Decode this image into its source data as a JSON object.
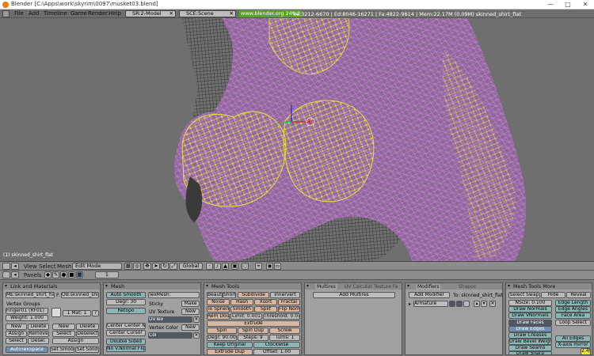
{
  "window": {
    "title": "Blender [C:\\Apps\\work\\skyrim\\0097\\musket03.blend]",
    "min": "—",
    "max": "□",
    "close": "✕"
  },
  "menu": {
    "items": [
      "File",
      "Add",
      "Timeline",
      "Game",
      "Render",
      "Help"
    ],
    "screen": "SR:2-Model",
    "scene": "SCE:Scene",
    "url": "www.blender.org 249.2",
    "stats": "Ve:3212-6670 | Ed:8046-16271 | Fa:4822-9614 | Mem:22.17M (0.09M) skinned_shirt_flat"
  },
  "viewport": {
    "object_label": "(1) skinned_shirt_flat"
  },
  "header3d": {
    "view": "View",
    "select": "Select",
    "mesh": "Mesh",
    "mode": "Edit Mode",
    "orientation": "Global"
  },
  "panelbar": {
    "panels": "Panels",
    "frame": "1"
  },
  "link_materials": {
    "title": "Link and Materials",
    "me": "ME:skinned_shirt_flat",
    "f": "F",
    "ob": "OB:skinned_shirt_flat",
    "vertex_groups": "Vertex Groups",
    "group_name": "Finger01 (RF01)",
    "weight": "Weight: 1.000",
    "mat": "1 Mat: 1",
    "new": "New",
    "delete": "Delete",
    "assign": "Assign",
    "remove": "Remove",
    "select": "Select",
    "desel": "Desel.",
    "deselect": "Deselect",
    "autotexspace": "AutoTexSpace",
    "set_smooth": "Set Smooth",
    "set_solid": "Set Solid",
    "q": "?"
  },
  "mesh_panel": {
    "title": "Mesh",
    "auto_smooth": "Auto Smooth",
    "degr": "Degr: 30",
    "retopo": "Retopo",
    "center_new": "Center Center New",
    "center_cursor": "Center Cursor",
    "double_sided": "Double Sided",
    "no_v_normal_flip": "No V.Normal Flip",
    "texmesh": "TexMesh:",
    "sticky": "Sticky",
    "make": "Make",
    "uv_texture": "UV Texture",
    "new": "New",
    "uvtex": "UVTex",
    "vertex_color": "Vertex Color",
    "col": "Col"
  },
  "mesh_tools": {
    "title": "Mesh Tools",
    "beauty": "Beauty",
    "short": "Short",
    "subdivide": "Subdivide",
    "innervert": "Innervert",
    "noise": "Noise",
    "hash": "Hash",
    "xsort": "Xsort",
    "fractal": "Fractal",
    "to_sphere": "To Sphere",
    "smooth": "Smooth",
    "split": "Split",
    "flip_normal": "Flip Normal",
    "rem_doubl": "Rem Doubl",
    "limit": "Limit: 0.001",
    "threshold": "Threshold: 0.010",
    "extrude": "Extrude",
    "spin": "Spin",
    "spin_dup": "Spin Dup",
    "screw": "Screw",
    "degr": "Degr: 90.00",
    "steps": "Steps: 9",
    "turns": "Turns: 1",
    "keep_original": "Keep Original",
    "clockwise": "Clockwise",
    "extrude_dup": "Extrude Dup",
    "offset": "Offset: 1.00"
  },
  "multires": {
    "tabs": [
      "Multires",
      "UV Calculat",
      "Texture Fa"
    ],
    "add": "Add Multires"
  },
  "modifiers": {
    "tabs": [
      "Modifiers",
      "Shapes"
    ],
    "add": "Add Modifier",
    "to": "To: skinned_shirt_flat",
    "armature": "Armature"
  },
  "mesh_tools_more": {
    "title": "Mesh Tools More",
    "select_swap": "Select Swap",
    "hide": "Hide",
    "reveal": "Reveal",
    "nsize": "NSize: 0.100",
    "draw_normals": "Draw Normals",
    "draw_vnormals": "Draw VNormals",
    "edge_length": "Edge Length",
    "edge_angles": "Edge Angles",
    "face_area": "Face Area",
    "draw_faces": "Draw Faces",
    "draw_edges": "Draw Edges",
    "draw_creases": "Draw Creases",
    "draw_bevel": "Draw Bevel Weights",
    "draw_seams": "Draw Seams",
    "draw_sharp": "Draw Sharp",
    "loop_select": "Loop Select",
    "all_edges": "All Edges",
    "xaxis_mirror": "X-axis mirror",
    "corner": "2.49"
  }
}
